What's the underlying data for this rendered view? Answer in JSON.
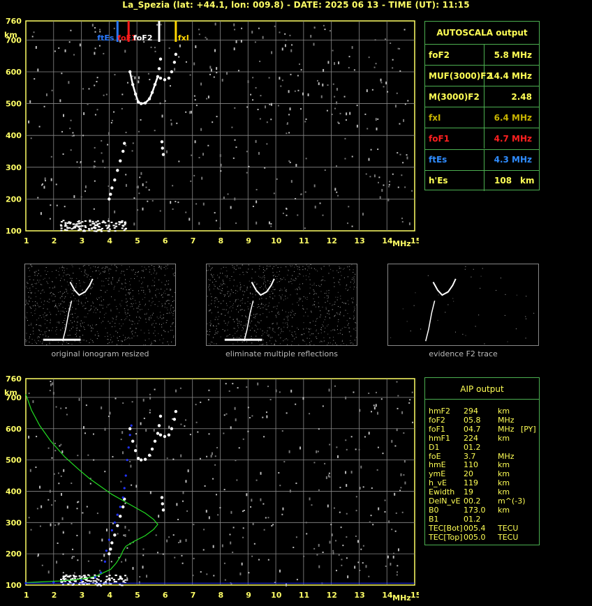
{
  "header": {
    "title": "La_Spezia (lat: +44.1, lon: 009.8) - DATE: 2025 06 13 - TIME (UT): 11:15"
  },
  "axes": {
    "y_ticks": [
      "100",
      "200",
      "300",
      "400",
      "500",
      "600",
      "700",
      "760"
    ],
    "y_unit": "km",
    "x_ticks": [
      "1",
      "2",
      "3",
      "4",
      "5",
      "6",
      "7",
      "8",
      "9",
      "10",
      "11",
      "12",
      "13",
      "14",
      "15"
    ],
    "x_unit": "MHz"
  },
  "markers": [
    {
      "label": "ftEs",
      "value": 4.3,
      "color": "#2979ff"
    },
    {
      "label": "foF1",
      "value": 4.7,
      "color": "#ff1a1a"
    },
    {
      "label": "foF2",
      "value": 5.8,
      "color": "#ffffff"
    },
    {
      "label": "fxI",
      "value": 6.4,
      "color": "#ffd600"
    }
  ],
  "autoscala": {
    "title": "AUTOSCALA output",
    "rows": [
      {
        "label": "foF2",
        "value": "5.8 MHz",
        "color": "#ffff55"
      },
      {
        "label": "MUF(3000)F2",
        "value": "14.4 MHz",
        "color": "#ffff55"
      },
      {
        "label": "M(3000)F2",
        "value": "2.48",
        "color": "#ffff55"
      },
      {
        "label": "fxI",
        "value": "6.4 MHz",
        "color": "#c8b400"
      },
      {
        "label": "foF1",
        "value": "4.7 MHz",
        "color": "#ff2020"
      },
      {
        "label": "ftEs",
        "value": "4.3 MHz",
        "color": "#2f8cff"
      },
      {
        "label": "h'Es",
        "value": "108",
        "unit": "km",
        "color": "#ffff55"
      }
    ]
  },
  "thumbnails": [
    {
      "caption": "original ionogram resized"
    },
    {
      "caption": "eliminate multiple reflections"
    },
    {
      "caption": "evidence F2 trace"
    }
  ],
  "aip": {
    "title": "AIP output",
    "rows": [
      {
        "k": "hmF2",
        "v": "294",
        "u": "km",
        "x": ""
      },
      {
        "k": "foF2",
        "v": "05.8",
        "u": "MHz",
        "x": ""
      },
      {
        "k": "foF1",
        "v": "04.7",
        "u": "MHz",
        "x": "[PY]"
      },
      {
        "k": "hmF1",
        "v": "224",
        "u": "km",
        "x": ""
      },
      {
        "k": "D1",
        "v": "01.2",
        "u": "",
        "x": ""
      },
      {
        "k": "foE",
        "v": "3.7",
        "u": "MHz",
        "x": ""
      },
      {
        "k": "hmE",
        "v": "110",
        "u": "km",
        "x": ""
      },
      {
        "k": "ymE",
        "v": "20",
        "u": "km",
        "x": ""
      },
      {
        "k": "h_vE",
        "v": "119",
        "u": "km",
        "x": ""
      },
      {
        "k": "Ewidth",
        "v": "19",
        "u": "km",
        "x": ""
      },
      {
        "k": "DelN_vE",
        "v": "00.2",
        "u": "m^(-3)",
        "x": ""
      },
      {
        "k": "B0",
        "v": "173.0",
        "u": "km",
        "x": ""
      },
      {
        "k": "B1",
        "v": "01.2",
        "u": "",
        "x": ""
      },
      {
        "k": "TEC[Bot]",
        "v": "005.4",
        "u": "TECU",
        "x": ""
      },
      {
        "k": "TEC[Top]",
        "v": "005.0",
        "u": "TECU",
        "x": ""
      }
    ]
  },
  "colors": {
    "frame": "#ffff66",
    "grid": "#8a8a8a",
    "panel_border": "#4caf50",
    "trace": "#ffffff",
    "profile": "#22dd22",
    "aip_points": "#2233ff"
  },
  "chart_data": [
    {
      "type": "scatter",
      "xlim": [
        1,
        15
      ],
      "ylim": [
        100,
        760
      ],
      "grid": true,
      "series": [
        {
          "values": [
            [
              4.0,
              200
            ],
            [
              4.05,
              215
            ],
            [
              4.1,
              235
            ],
            [
              4.2,
              260
            ],
            [
              4.3,
              290
            ],
            [
              4.4,
              320
            ],
            [
              4.5,
              350
            ],
            [
              4.55,
              375
            ],
            [
              4.75,
              600
            ],
            [
              4.85,
              560
            ],
            [
              4.95,
              530
            ],
            [
              5.05,
              505
            ],
            [
              5.15,
              500
            ],
            [
              5.3,
              502
            ],
            [
              5.45,
              515
            ],
            [
              5.55,
              535
            ],
            [
              5.65,
              560
            ],
            [
              5.75,
              585
            ],
            [
              5.8,
              610
            ],
            [
              5.85,
              640
            ],
            [
              5.85,
              580
            ],
            [
              6.0,
              575
            ],
            [
              6.15,
              580
            ],
            [
              6.25,
              600
            ],
            [
              6.35,
              630
            ],
            [
              6.4,
              655
            ],
            [
              5.9,
              380
            ],
            [
              5.92,
              360
            ],
            [
              5.95,
              340
            ]
          ]
        }
      ]
    },
    {
      "type": "line",
      "xlim": [
        1,
        15
      ],
      "ylim": [
        100,
        760
      ],
      "grid": true,
      "series": [
        {
          "values": [
            [
              1.0,
              710
            ],
            [
              1.2,
              660
            ],
            [
              1.5,
              610
            ],
            [
              1.9,
              560
            ],
            [
              2.4,
              510
            ],
            [
              2.9,
              470
            ],
            [
              3.3,
              440
            ],
            [
              3.7,
              415
            ],
            [
              4.1,
              390
            ],
            [
              4.5,
              370
            ],
            [
              4.9,
              350
            ],
            [
              5.3,
              330
            ],
            [
              5.6,
              310
            ],
            [
              5.75,
              294
            ],
            [
              5.6,
              278
            ],
            [
              5.3,
              258
            ],
            [
              4.9,
              240
            ],
            [
              4.6,
              224
            ],
            [
              4.5,
              210
            ],
            [
              4.4,
              190
            ],
            [
              4.25,
              170
            ],
            [
              4.05,
              150
            ],
            [
              3.8,
              140
            ],
            [
              3.7,
              135
            ],
            [
              3.5,
              128
            ],
            [
              3.2,
              122
            ],
            [
              2.8,
              117
            ],
            [
              2.2,
              113
            ],
            [
              1.5,
              110
            ],
            [
              1.0,
              108
            ]
          ]
        },
        {
          "values": [
            [
              1.0,
              106
            ],
            [
              2.0,
              108
            ],
            [
              3.0,
              115
            ],
            [
              3.5,
              125
            ],
            [
              3.7,
              140
            ],
            [
              3.85,
              175
            ],
            [
              3.9,
              210
            ],
            [
              4.0,
              245
            ],
            [
              4.1,
              275
            ],
            [
              4.2,
              300
            ],
            [
              4.3,
              325
            ],
            [
              4.4,
              350
            ],
            [
              4.5,
              380
            ],
            [
              4.55,
              410
            ],
            [
              4.6,
              450
            ],
            [
              4.65,
              500
            ],
            [
              4.7,
              540
            ],
            [
              4.75,
              580
            ],
            [
              4.8,
              610
            ]
          ]
        }
      ]
    }
  ]
}
